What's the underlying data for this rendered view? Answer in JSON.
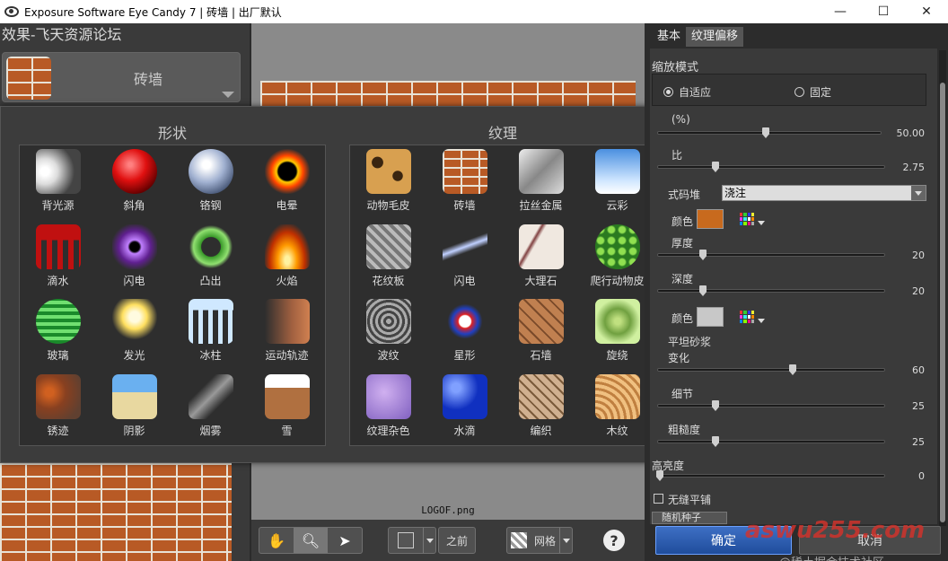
{
  "window": {
    "title": "Exposure Software Eye Candy 7 | 砖墙 | 出厂默认",
    "minimize": "—",
    "maximize": "☐",
    "close": "✕"
  },
  "left": {
    "header": "效果-飞天资源论坛",
    "preset_name": "砖墙"
  },
  "canvas": {
    "filename": "LOGOF.png"
  },
  "toolbar": {
    "before_label": "之前",
    "grid_label": "网格",
    "help_label": "?"
  },
  "popup": {
    "shapes_title": "形状",
    "textures_title": "纹理",
    "shapes": [
      {
        "label": "背光源",
        "icon": "backlight-icon"
      },
      {
        "label": "斜角",
        "icon": "bevel-icon"
      },
      {
        "label": "铬钢",
        "icon": "chrome-icon"
      },
      {
        "label": "电晕",
        "icon": "corona-icon"
      },
      {
        "label": "滴水",
        "icon": "drip-icon"
      },
      {
        "label": "闪电",
        "icon": "lightning-icon"
      },
      {
        "label": "凸出",
        "icon": "extrude-icon"
      },
      {
        "label": "火焰",
        "icon": "fire-icon"
      },
      {
        "label": "玻璃",
        "icon": "glass-icon"
      },
      {
        "label": "发光",
        "icon": "glow-icon"
      },
      {
        "label": "冰柱",
        "icon": "icicle-icon"
      },
      {
        "label": "运动轨迹",
        "icon": "motion-trail-icon"
      },
      {
        "label": "锈迹",
        "icon": "rust-icon"
      },
      {
        "label": "阴影",
        "icon": "shadow-icon"
      },
      {
        "label": "烟雾",
        "icon": "smoke-icon"
      },
      {
        "label": "雪",
        "icon": "snow-icon"
      }
    ],
    "textures": [
      {
        "label": "动物毛皮",
        "icon": "animal-fur-icon"
      },
      {
        "label": "砖墙",
        "icon": "brick-wall-icon"
      },
      {
        "label": "拉丝金属",
        "icon": "brushed-metal-icon"
      },
      {
        "label": "云彩",
        "icon": "clouds-icon"
      },
      {
        "label": "花纹板",
        "icon": "diamond-plate-icon"
      },
      {
        "label": "闪电",
        "icon": "lightning-texture-icon"
      },
      {
        "label": "大理石",
        "icon": "marble-icon"
      },
      {
        "label": "爬行动物皮",
        "icon": "reptile-skin-icon"
      },
      {
        "label": "波纹",
        "icon": "ripples-icon"
      },
      {
        "label": "星形",
        "icon": "star-icon"
      },
      {
        "label": "石墙",
        "icon": "stone-wall-icon"
      },
      {
        "label": "旋绕",
        "icon": "swirl-icon"
      },
      {
        "label": "纹理杂色",
        "icon": "texture-noise-icon"
      },
      {
        "label": "水滴",
        "icon": "water-drops-icon"
      },
      {
        "label": "编织",
        "icon": "weave-icon"
      },
      {
        "label": "木纹",
        "icon": "wood-icon"
      }
    ]
  },
  "right": {
    "tab_basic": "基本",
    "tab_offset": "纹理偏移",
    "scale_mode_label": "缩放模式",
    "radio_fit": "自适应",
    "radio_fixed": "固定",
    "scale_label": "(%)",
    "scale_value": "50.00",
    "ratio_label": "比",
    "ratio_value": "2.75",
    "pattern_label": "式码堆",
    "pattern_value": "浇注",
    "color1_label": "颜色",
    "thickness_label": "厚度",
    "thickness_value": "20",
    "depth_label": "深度",
    "depth_value": "20",
    "color2_label": "颜色",
    "mortar_label": "平坦砂浆",
    "variation_label": "变化",
    "variation_value": "60",
    "detail_label": "细节",
    "detail_value": "25",
    "roughness_label": "粗糙度",
    "roughness_value": "25",
    "brightness_label": "高亮度",
    "brightness_value": "0",
    "seamless_label": "无缝平铺",
    "random_seed_label": "随机种子",
    "ok_label": "确定",
    "cancel_label": "取消"
  },
  "colors": {
    "brick": "#b85a25",
    "color1": "#c86a1e",
    "color2": "#c8c8c8",
    "ok_button": "#2f5fb3"
  },
  "watermarks": {
    "community": "@稀土掘金技术社区",
    "site": "aswu255.com"
  }
}
